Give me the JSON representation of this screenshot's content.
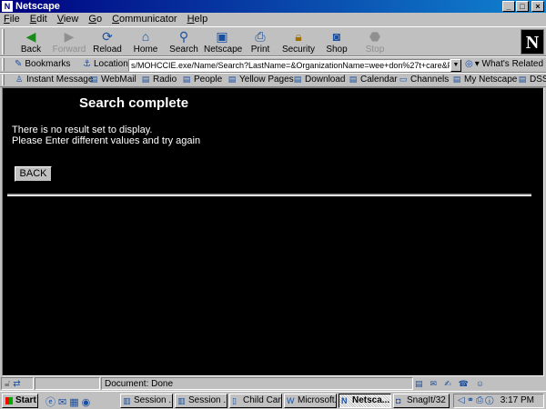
{
  "window": {
    "title": "Netscape",
    "icon": "netscape-app-icon",
    "controls": [
      "_",
      "□",
      "×"
    ]
  },
  "menu": [
    {
      "label": "File",
      "u": "F",
      "rest": "ile"
    },
    {
      "label": "Edit",
      "u": "E",
      "rest": "dit"
    },
    {
      "label": "View",
      "u": "V",
      "rest": "iew"
    },
    {
      "label": "Go",
      "u": "G",
      "rest": "o"
    },
    {
      "label": "Communicator",
      "u": "C",
      "rest": "ommunicator"
    },
    {
      "label": "Help",
      "u": "H",
      "rest": "elp"
    }
  ],
  "toolbar": {
    "back": "Back",
    "forward": "Forward",
    "reload": "Reload",
    "home": "Home",
    "search": "Search",
    "netscape": "Netscape",
    "print": "Print",
    "security": "Security",
    "shop": "Shop",
    "stop": "Stop"
  },
  "location": {
    "bookmarks": "Bookmarks",
    "label": "Location:",
    "url": "s/MOHCCIE.exe/Name/Search?LastName=&OrganizationName=wee+don%27t+care&FirstName=",
    "related": "What's Related"
  },
  "personal": {
    "instant_message": "Instant Message",
    "webmail": "WebMail",
    "radio": "Radio",
    "people": "People",
    "yellow_pages": "Yellow Pages",
    "download": "Download",
    "calendar": "Calendar",
    "channels": "Channels",
    "my_netscape": "My Netscape",
    "dss": "DSS"
  },
  "page": {
    "heading": "Search complete",
    "line1": "There is no result set to display.",
    "line2": "Please Enter different values and try again",
    "back_button": "BACK"
  },
  "status": {
    "text": "Document: Done"
  },
  "taskbar": {
    "start": "Start",
    "tasks": {
      "session1": "Session ...",
      "session2": "Session ...",
      "childcare": "Child Car...",
      "microsoft": "Microsoft...",
      "netscape": "Netsca...",
      "snagit": "SnagIt/32"
    },
    "clock": "3:17 PM"
  }
}
